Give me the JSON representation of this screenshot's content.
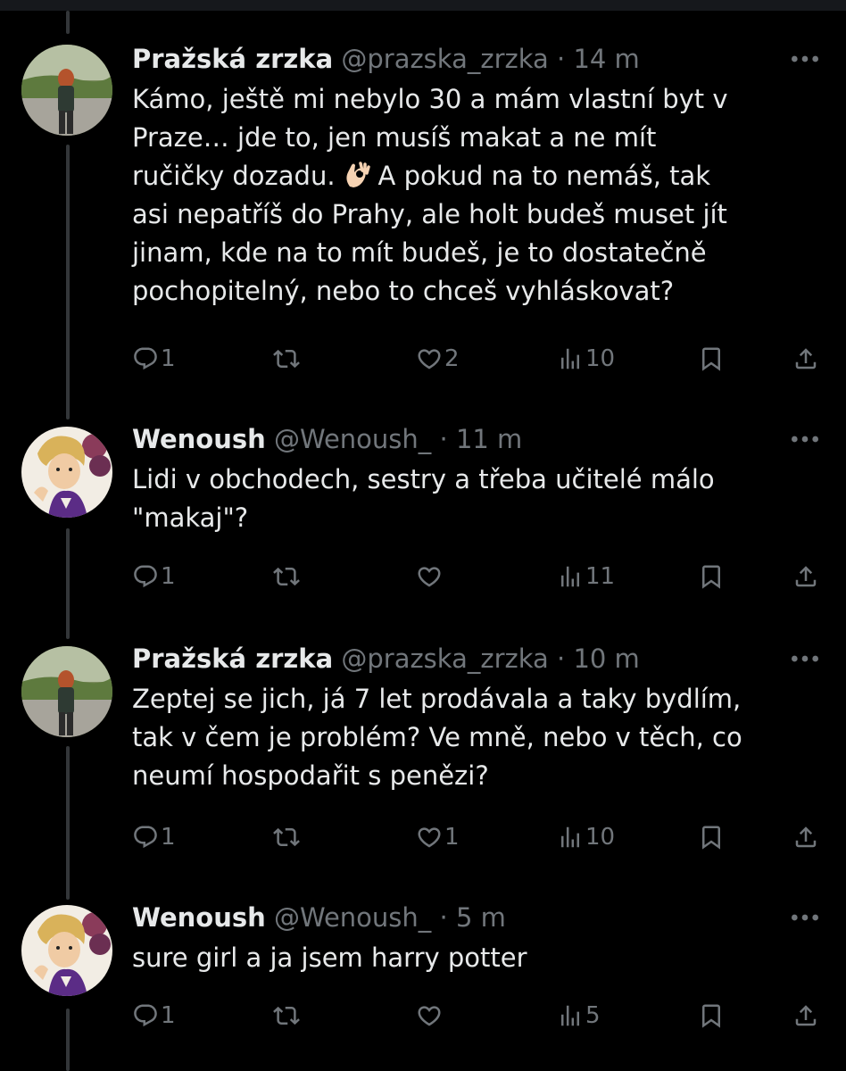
{
  "tweets": [
    {
      "name": "Pražská zrzka",
      "handle": "@prazska_zrzka",
      "separator": "·",
      "time": "14 m",
      "text_lines": [
        "Kámo, ještě mi nebylo 30 a mám vlastní byt v",
        "Praze… jde to, jen musíš makat a ne mít",
        "ručičky dozadu.",
        "asi nepatříš do Prahy, ale holt budeš muset jít",
        "jinam, kde na to mít budeš, je to dostatečně",
        "pochopitelný, nebo to chceš vyhláskovat?"
      ],
      "text_line3_after_emoji": "A pokud na to nemáš, tak",
      "emoji": "ok-hand-emoji",
      "replies": "1",
      "retweets": "",
      "likes": "2",
      "views": "10"
    },
    {
      "name": "Wenoush",
      "handle": "@Wenoush_",
      "separator": "·",
      "time": "11 m",
      "text_lines": [
        "Lidi v obchodech, sestry a třeba učitelé málo",
        "\"makaj\"?"
      ],
      "replies": "1",
      "retweets": "",
      "likes": "",
      "views": "11"
    },
    {
      "name": "Pražská zrzka",
      "handle": "@prazska_zrzka",
      "separator": "·",
      "time": "10 m",
      "text_lines": [
        "Zeptej se jich, já 7 let prodávala a taky bydlím,",
        "tak v čem je problém? Ve mně, nebo v těch, co",
        "neumí hospodařit s penězi?"
      ],
      "replies": "1",
      "retweets": "",
      "likes": "1",
      "views": "10"
    },
    {
      "name": "Wenoush",
      "handle": "@Wenoush_",
      "separator": "·",
      "time": "5 m",
      "text_lines": [
        "sure girl a ja jsem harry potter"
      ],
      "replies": "1",
      "retweets": "",
      "likes": "",
      "views": "5"
    }
  ],
  "icons": {
    "reply": "reply-icon",
    "retweet": "retweet-icon",
    "like": "heart-icon",
    "views": "views-icon",
    "bookmark": "bookmark-icon",
    "share": "share-icon",
    "more": "more-icon"
  },
  "colors": {
    "background": "#000000",
    "text": "#e7e9ea",
    "muted": "#71767b",
    "thread_line": "#333639"
  }
}
